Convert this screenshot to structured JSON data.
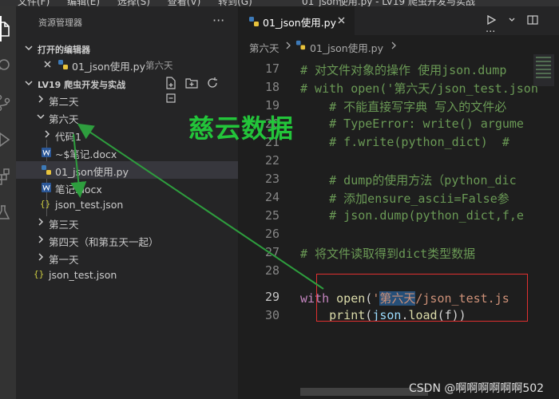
{
  "menu": [
    "文件(F)",
    "编辑(E)",
    "选择(S)",
    "查看(V)",
    "转到(G)"
  ],
  "window_title": "01_json使用.py - LV19 爬虫开发与实战",
  "sidebar": {
    "title": "资源管理器",
    "more": "···",
    "open_editors": {
      "label": "打开的编辑器",
      "items": [
        {
          "name": "01_json使用.py",
          "desc": "第六天"
        }
      ]
    },
    "project": {
      "label": "LV19 爬虫开发与实战",
      "tree": [
        {
          "name": "第二天",
          "kind": "folder",
          "expanded": false
        },
        {
          "name": "第六天",
          "kind": "folder",
          "expanded": true
        },
        {
          "name": "代码1",
          "kind": "folder",
          "expanded": false
        },
        {
          "name": "~$笔记.docx",
          "kind": "word"
        },
        {
          "name": "01_json使用.py",
          "kind": "python",
          "selected": true
        },
        {
          "name": "笔记.docx",
          "kind": "word"
        },
        {
          "name": "json_test.json",
          "kind": "json"
        },
        {
          "name": "第三天",
          "kind": "folder",
          "expanded": false
        },
        {
          "name": "第四天（和第五天一起）",
          "kind": "folder",
          "expanded": false
        },
        {
          "name": "第一天",
          "kind": "folder",
          "expanded": false
        },
        {
          "name": "json_test.json",
          "kind": "json"
        }
      ]
    }
  },
  "editor": {
    "tab_name": "01_json使用.py",
    "breadcrumb": [
      "第六天",
      "01_json使用.py"
    ],
    "lines": [
      {
        "n": "17",
        "text": "# 对文件对象的操作 使用json.dump"
      },
      {
        "n": "18",
        "text": "# with open('第六天/json_test.json"
      },
      {
        "n": "19",
        "text": "    # 不能直接写字典 写入的文件必"
      },
      {
        "n": "20",
        "text": "    # TypeError: write() argume"
      },
      {
        "n": "21",
        "text": "    # f.write(python_dict)  # "
      },
      {
        "n": "22",
        "text": ""
      },
      {
        "n": "23",
        "text": "    # dump的使用方法（python_dic"
      },
      {
        "n": "24",
        "text": "    # 添加ensure_ascii=False参"
      },
      {
        "n": "25",
        "text": "    # json.dump(python_dict,f,e"
      },
      {
        "n": "26",
        "text": ""
      },
      {
        "n": "27",
        "text": "# 将文件读取得到dict类型数据"
      },
      {
        "n": "28",
        "text": ""
      },
      {
        "n": "29",
        "text": "",
        "kw": "with",
        "fn": "open",
        "p1": "(",
        "q": "'",
        "hl": "第六天",
        "str_rest": "/json_test.js"
      },
      {
        "n": "30",
        "text": "",
        "indent": "    ",
        "fn1": "print",
        "p1": "(",
        "var": "json",
        "dot": ".",
        "fn2": "load",
        "args": "(f))"
      }
    ]
  },
  "watermark": "慈云数据",
  "credit": "CSDN @啊啊啊啊啊啊502",
  "colors": {
    "comment": "#6a9955",
    "keyword": "#c586c0",
    "function": "#dcdcaa",
    "string": "#ce9178",
    "arrow": "#2e9e3e",
    "box": "#e03030"
  }
}
